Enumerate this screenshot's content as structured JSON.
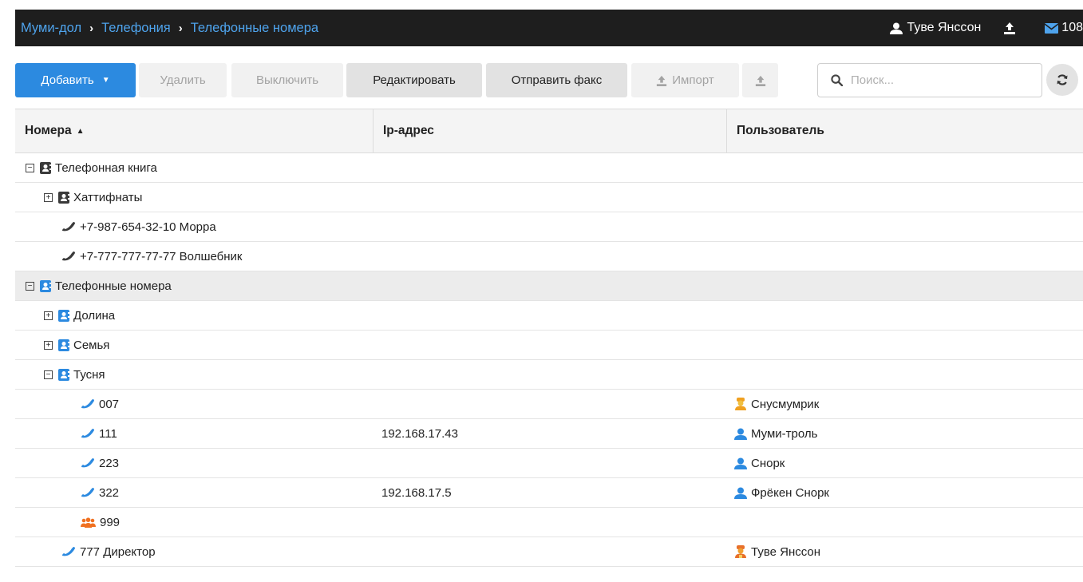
{
  "breadcrumb": [
    "Муми-дол",
    "Телефония",
    "Телефонные номера"
  ],
  "top": {
    "user_name": "Туве Янссон",
    "mail_count": "108"
  },
  "toolbar": {
    "add_label": "Добавить",
    "delete_label": "Удалить",
    "disable_label": "Выключить",
    "edit_label": "Редактировать",
    "fax_label": "Отправить факс",
    "import_label": "Импорт",
    "search_placeholder": "Поиск..."
  },
  "columns": {
    "numbers": "Номера",
    "ip": "Ip-адрес",
    "user": "Пользователь"
  },
  "rows": [
    {
      "label": "Телефонная книга",
      "ip": "",
      "user": ""
    },
    {
      "label": "Хаттифнаты",
      "ip": "",
      "user": ""
    },
    {
      "label": "+7-987-654-32-10 Морра",
      "ip": "",
      "user": ""
    },
    {
      "label": "+7-777-777-77-77 Волшебник",
      "ip": "",
      "user": ""
    },
    {
      "label": "Телефонные номера",
      "ip": "",
      "user": ""
    },
    {
      "label": "Долина",
      "ip": "",
      "user": ""
    },
    {
      "label": "Семья",
      "ip": "",
      "user": ""
    },
    {
      "label": "Тусня",
      "ip": "",
      "user": ""
    },
    {
      "label": "007",
      "ip": "",
      "user": "Снусмумрик"
    },
    {
      "label": "111",
      "ip": "192.168.17.43",
      "user": "Муми-троль"
    },
    {
      "label": "223",
      "ip": "",
      "user": "Снорк"
    },
    {
      "label": "322",
      "ip": "192.168.17.5",
      "user": "Фрёкен Снорк"
    },
    {
      "label": "999",
      "ip": "",
      "user": ""
    },
    {
      "label": "777 Директор",
      "ip": "",
      "user": "Туве Янссон"
    }
  ],
  "colors": {
    "accent": "#2c8ae0",
    "topbar": "#1e1e1e",
    "link": "#4ea3ec",
    "orange": "#f0a020",
    "dark_icon": "#3a3a3a"
  },
  "icons": [
    "user-icon",
    "upload-icon",
    "mail-icon",
    "search-icon",
    "refresh-icon",
    "contact-book-icon",
    "phone-icon",
    "group-icon",
    "user-badge-icon"
  ]
}
